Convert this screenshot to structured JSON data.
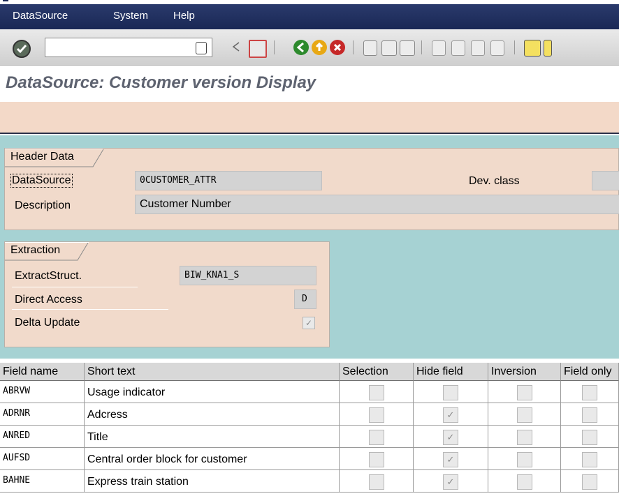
{
  "menu": {
    "items": [
      "DataSource",
      "System",
      "Help"
    ]
  },
  "toolbar": {
    "command_value": ""
  },
  "page": {
    "title": "DataSource: Customer version Display"
  },
  "header_data": {
    "tab_label": "Header Data",
    "datasource_label": "DataSource",
    "datasource_value": "0CUSTOMER_ATTR",
    "description_label": "Description",
    "description_value": "Customer Number",
    "devclass_label": "Dev. class",
    "devclass_value": ""
  },
  "extraction": {
    "tab_label": "Extraction",
    "extractstruct_label": "ExtractStruct.",
    "extractstruct_value": "BIW_KNA1_S",
    "direct_access_label": "Direct Access",
    "direct_access_value": "D",
    "delta_update_label": "Delta Update",
    "delta_update_checked": true
  },
  "table": {
    "columns": [
      "Field name",
      "Short text",
      "Selection",
      "Hide field",
      "Inversion",
      "Field only"
    ],
    "rows": [
      {
        "field": "ABRVW",
        "text": "Usage indicator",
        "selection": false,
        "hide": false,
        "inversion": false,
        "field_only": false
      },
      {
        "field": "ADRNR",
        "text": "Adcress",
        "selection": false,
        "hide": true,
        "inversion": false,
        "field_only": false
      },
      {
        "field": "ANRED",
        "text": "Title",
        "selection": false,
        "hide": true,
        "inversion": false,
        "field_only": false
      },
      {
        "field": "AUFSD",
        "text": "Central order block for customer",
        "selection": false,
        "hide": true,
        "inversion": false,
        "field_only": false
      },
      {
        "field": "BAHNE",
        "text": "Express train station",
        "selection": false,
        "hide": true,
        "inversion": false,
        "field_only": false
      }
    ]
  },
  "colors": {
    "menubar": "#1a2855",
    "panel": "#f1dacb",
    "background_teal": "#a6d2d3",
    "title_text": "#5e6370"
  }
}
